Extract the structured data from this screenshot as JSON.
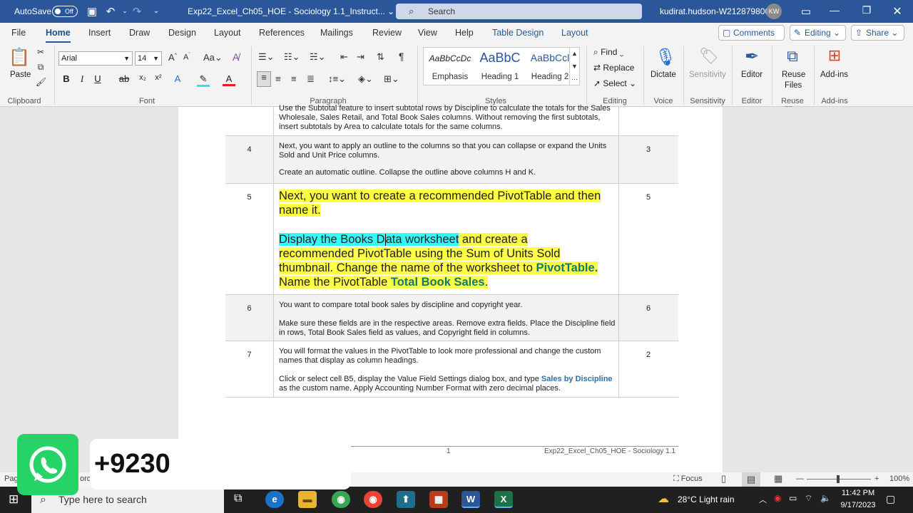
{
  "titlebar": {
    "autosave": "AutoSave",
    "autosave_state": "Off",
    "doc_title": "Exp22_Excel_Ch05_HOE - Sociology 1.1_Instruct... ⌄",
    "search": "Search",
    "user": "kudirat.hudson-W212879806",
    "avatar": "KW"
  },
  "tabs": [
    "File",
    "Home",
    "Insert",
    "Draw",
    "Design",
    "Layout",
    "References",
    "Mailings",
    "Review",
    "View",
    "Help",
    "Table Design",
    "Layout"
  ],
  "tab_buttons": {
    "comments": "Comments",
    "editing": "Editing ⌄",
    "share": "Share ⌄"
  },
  "ribbon": {
    "clipboard": {
      "paste": "Paste",
      "label": "Clipboard"
    },
    "font": {
      "name": "Arial",
      "size": "14",
      "label": "Font"
    },
    "paragraph": {
      "label": "Paragraph"
    },
    "styles": {
      "label": "Styles",
      "items": [
        {
          "preview": "AaBbCcDc",
          "name": "Emphasis"
        },
        {
          "preview": "AaBbC",
          "name": "Heading 1"
        },
        {
          "preview": "AaBbCcl",
          "name": "Heading 2"
        }
      ]
    },
    "editing": {
      "find": "Find ⌄",
      "replace": "Replace",
      "select": "Select ⌄",
      "label": "Editing"
    },
    "voice": {
      "dictate": "Dictate",
      "label": "Voice"
    },
    "sensitivity": {
      "button": "Sensitivity",
      "label": "Sensitivity"
    },
    "editor": {
      "button": "Editor",
      "label": "Editor"
    },
    "reuse": {
      "button1": "Reuse",
      "button2": "Files",
      "label": "Reuse Files"
    },
    "addins": {
      "button": "Add-ins",
      "label": "Add-ins"
    }
  },
  "document": {
    "row3_text": "Use the Subtotal feature to insert subtotal rows by Discipline to calculate the totals for the Sales Wholesale, Sales Retail, and Total Book Sales columns. Without removing the first subtotals, insert subtotals by Area to calculate totals for the same columns.",
    "rows": [
      {
        "num": "4",
        "points": "3",
        "p1": "Next, you want to apply an outline to the columns so that you can collapse or expand the Units Sold and Unit Price columns.",
        "p2": "Create an automatic outline. Collapse the outline above columns H and K."
      },
      {
        "num": "5",
        "points": "5",
        "p1": "Next, you want to create a recommended PivotTable and then name it.",
        "p2_cyan_a": "Display the Books D",
        "p2_cyan_b": "ata worksheet",
        "p2_rest": " and create a recommended PivotTable using the Sum of Units Sold thumbnail. Change the name of the worksheet to ",
        "p2_b1": "PivotTable.",
        "p2_mid": " Name the PivotTable ",
        "p2_b2": "Total Book Sales",
        "p2_end": "."
      },
      {
        "num": "6",
        "points": "6",
        "p1": "You want to compare total book sales by discipline and copyright year.",
        "p2": "Make sure these fields are in the respective areas. Remove extra fields. Place the Discipline field in rows, Total Book Sales field as values, and Copyright field in columns."
      },
      {
        "num": "7",
        "points": "2",
        "p1": "You will format the values in the PivotTable to look more professional and change the custom names that display as column headings.",
        "p2_a": "Click or select cell B5, display the Value Field Settings dialog box, and type ",
        "p2_b": "Sales by Discipline",
        "p2_c": " as the custom name. Apply Accounting Number Format with zero decimal places."
      }
    ],
    "footer_page": "1",
    "footer_doc": "Exp22_Excel_Ch05_HOE - Sociology 1.1"
  },
  "statusbar": {
    "page": "Pag",
    "words": "ord.",
    "focus": "Focus",
    "zoom": "100%"
  },
  "overlay": {
    "phone": "+9230"
  },
  "taskbar": {
    "search": "Type here to search",
    "weather": "28°C  Light rain",
    "time": "11:42 PM",
    "date": "9/17/2023"
  }
}
